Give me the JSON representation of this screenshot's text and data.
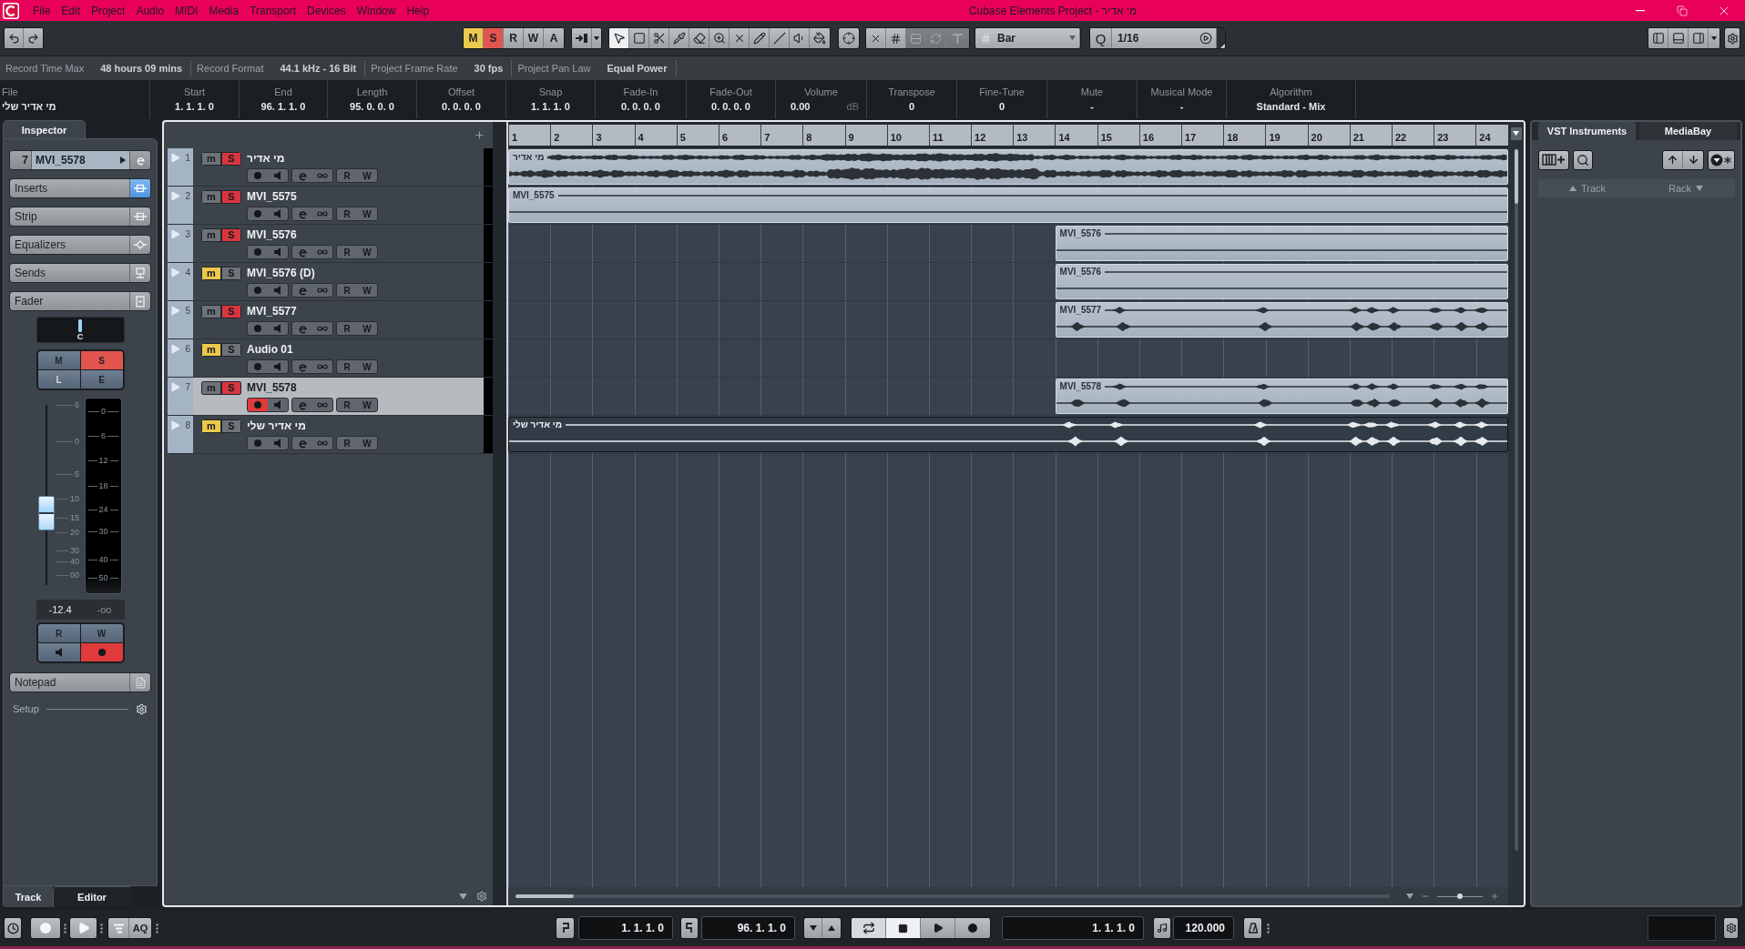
{
  "window": {
    "title": "Cubase Elements Project - מי אדיר",
    "menu": [
      "File",
      "Edit",
      "Project",
      "Audio",
      "MIDI",
      "Media",
      "Transport",
      "Devices",
      "Window",
      "Help"
    ]
  },
  "toolbar": {
    "state_buttons": [
      {
        "label": "M",
        "on": true,
        "kind": "mute"
      },
      {
        "label": "S",
        "on": true,
        "kind": "solo"
      },
      {
        "label": "R",
        "on": false,
        "kind": "read"
      },
      {
        "label": "W",
        "on": false,
        "kind": "write"
      },
      {
        "label": "A",
        "on": false,
        "kind": "auto"
      }
    ],
    "tools": [
      {
        "selected": true
      },
      {
        "selected": false
      },
      {
        "selected": false
      },
      {
        "selected": false
      },
      {
        "selected": false
      },
      {
        "selected": false
      },
      {
        "selected": false
      },
      {
        "selected": false
      },
      {
        "selected": false
      },
      {
        "selected": false
      },
      {
        "selected": false
      }
    ],
    "snap_buttons": [
      {
        "disabled": false
      },
      {
        "disabled": false
      },
      {
        "disabled": true
      },
      {
        "disabled": true
      },
      {
        "disabled": true
      }
    ],
    "grid_type": "Bar",
    "quantize_label": "Q",
    "quantize": "1/16"
  },
  "info_line": [
    {
      "label": "Record Time Max",
      "value": "48 hours 09 mins"
    },
    {
      "label": "Record Format",
      "value": "44.1 kHz - 16 Bit"
    },
    {
      "label": "Project Frame Rate",
      "value": "30 fps"
    },
    {
      "label": "Project Pan Law",
      "value": "Equal Power"
    }
  ],
  "event_info": [
    {
      "label": "File",
      "value": "מי אדיר שלי"
    },
    {
      "label": "Start",
      "value": "1. 1. 1. 0"
    },
    {
      "label": "End",
      "value": "96. 1. 1. 0"
    },
    {
      "label": "Length",
      "value": "95. 0. 0. 0"
    },
    {
      "label": "Offset",
      "value": "0. 0. 0. 0"
    },
    {
      "label": "Snap",
      "value": "1. 1. 1. 0"
    },
    {
      "label": "Fade-In",
      "value": "0. 0. 0. 0"
    },
    {
      "label": "Fade-Out",
      "value": "0. 0. 0. 0"
    },
    {
      "label": "Volume",
      "value": "0.00",
      "unit": "dB"
    },
    {
      "label": "Transpose",
      "value": "0"
    },
    {
      "label": "Fine-Tune",
      "value": "0"
    },
    {
      "label": "Mute",
      "value": "-"
    },
    {
      "label": "Musical Mode",
      "value": "-"
    },
    {
      "label": "Algorithm",
      "value": "Standard - Mix"
    }
  ],
  "inspector": {
    "tab": "Inspector",
    "track_number": "7",
    "track_name": "MVI_5578",
    "sections": [
      {
        "label": "Inserts",
        "active": true
      },
      {
        "label": "Strip",
        "active": false
      },
      {
        "label": "Equalizers",
        "active": false
      },
      {
        "label": "Sends",
        "active": false
      },
      {
        "label": "Fader",
        "active": false
      }
    ],
    "pan": "C",
    "channel_buttons": [
      {
        "label": "M",
        "on": false,
        "kind": "mute",
        "disabled": false
      },
      {
        "label": "S",
        "on": true,
        "kind": "solo",
        "disabled": false
      },
      {
        "label": "L",
        "on": false,
        "kind": "listen",
        "disabled": true
      },
      {
        "label": "E",
        "on": false,
        "kind": "edit",
        "disabled": false
      }
    ],
    "fader": {
      "level": 0.4,
      "scale": [
        "6",
        "0",
        "5",
        "10",
        "15",
        "20",
        "30",
        "40",
        "00"
      ]
    },
    "meter_scale": [
      "0",
      "6",
      "12",
      "18",
      "24",
      "30",
      "40",
      "50"
    ],
    "volume": "-12.4",
    "peak": "-oo",
    "automation_buttons": [
      {
        "label": "R",
        "on": false
      },
      {
        "label": "W",
        "on": false
      }
    ],
    "monitor": false,
    "record_enabled": true,
    "notepad": "Notepad",
    "setup": "Setup"
  },
  "inspector_tabs": [
    {
      "label": "Track",
      "selected": true
    },
    {
      "label": "Editor",
      "selected": false
    }
  ],
  "tracks": [
    {
      "number": "1",
      "name": "מי אדיר",
      "selected": false,
      "mute": {
        "label": "m",
        "on": false
      },
      "solo": {
        "label": "S",
        "on": true
      },
      "record_enabled": false,
      "read": "R",
      "write": "W",
      "event": {
        "label": "מי אדיר",
        "kind": "dense",
        "selected": false
      }
    },
    {
      "number": "2",
      "name": "MVI_5575",
      "selected": false,
      "mute": {
        "label": "m",
        "on": false
      },
      "solo": {
        "label": "S",
        "on": true
      },
      "record_enabled": false,
      "read": "R",
      "write": "W",
      "event": {
        "label": "MVI_5575",
        "kind": "flat",
        "selected": false
      }
    },
    {
      "number": "3",
      "name": "MVI_5576",
      "selected": false,
      "mute": {
        "label": "m",
        "on": false
      },
      "solo": {
        "label": "S",
        "on": true
      },
      "record_enabled": false,
      "read": "R",
      "write": "W",
      "event": {
        "label": "MVI_5576",
        "kind": "flat",
        "selected": false
      }
    },
    {
      "number": "4",
      "name": "MVI_5576 (D)",
      "selected": false,
      "mute": {
        "label": "m",
        "on": true
      },
      "solo": {
        "label": "S",
        "on": false
      },
      "record_enabled": false,
      "read": "R",
      "write": "W",
      "event": {
        "label": "MVI_5576",
        "kind": "flat",
        "selected": false
      }
    },
    {
      "number": "5",
      "name": "MVI_5577",
      "selected": false,
      "mute": {
        "label": "m",
        "on": false
      },
      "solo": {
        "label": "S",
        "on": true
      },
      "record_enabled": false,
      "read": "R",
      "write": "W",
      "event": {
        "label": "MVI_5577",
        "kind": "sparse",
        "selected": false
      }
    },
    {
      "number": "6",
      "name": "Audio 01",
      "selected": false,
      "mute": {
        "label": "m",
        "on": true
      },
      "solo": {
        "label": "S",
        "on": false
      },
      "record_enabled": false,
      "read": "R",
      "write": "W"
    },
    {
      "number": "7",
      "name": "MVI_5578",
      "selected": true,
      "mute": {
        "label": "m",
        "on": false
      },
      "solo": {
        "label": "S",
        "on": true
      },
      "record_enabled": true,
      "read": "R",
      "write": "W",
      "event": {
        "label": "MVI_5578",
        "kind": "sparse",
        "selected": false
      }
    },
    {
      "number": "8",
      "name": "מי אדיר שלי",
      "selected": false,
      "mute": {
        "label": "m",
        "on": true
      },
      "solo": {
        "label": "S",
        "on": false
      },
      "record_enabled": false,
      "read": "R",
      "write": "W",
      "event": {
        "label": "מי אדיר שלי",
        "kind": "sparse",
        "selected": true
      }
    }
  ],
  "ruler": [
    "1",
    "2",
    "3",
    "4",
    "5",
    "6",
    "7",
    "8",
    "9",
    "10",
    "11",
    "12",
    "13",
    "14",
    "15",
    "16",
    "17",
    "18",
    "19",
    "20",
    "21",
    "22",
    "23",
    "24"
  ],
  "zoom_slider": {
    "level": 0.5
  },
  "right_zone": {
    "tabs": [
      {
        "label": "VST Instruments",
        "selected": true
      },
      {
        "label": "MediaBay",
        "selected": false
      }
    ],
    "columns": [
      "Track",
      "Rack"
    ]
  },
  "transport": {
    "aq_label": "AQ",
    "left_locator": "1. 1. 1. 0",
    "right_locator": "96. 1. 1. 0",
    "position": "1. 1. 1. 0",
    "tempo": "120.000"
  }
}
